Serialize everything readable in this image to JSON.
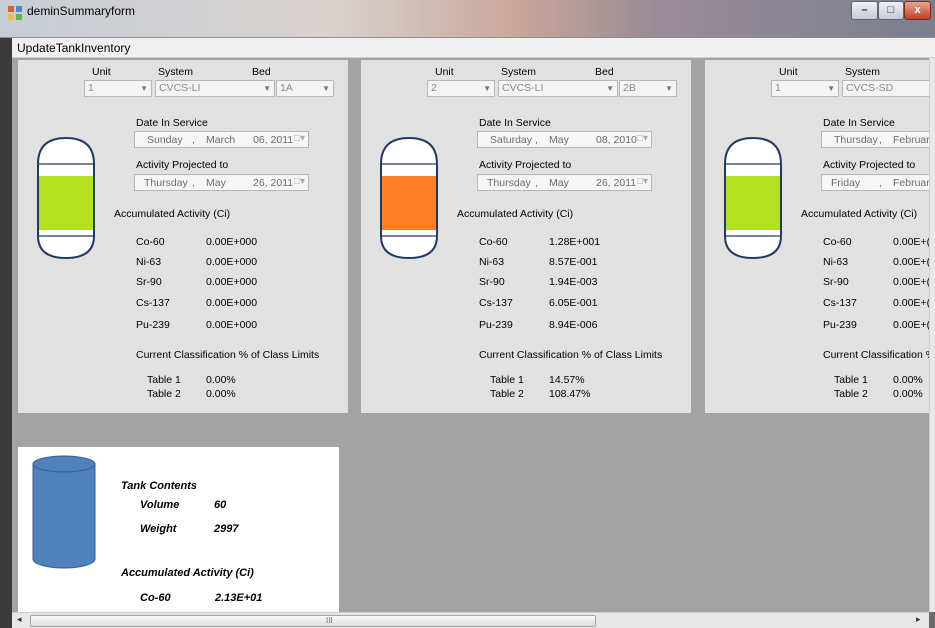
{
  "window": {
    "title": "deminSummaryform"
  },
  "menu": {
    "update_label": "UpdateTankInventory"
  },
  "caption": {
    "min": "–",
    "max": "□",
    "close": "x"
  },
  "panels": [
    {
      "headers": {
        "unit": "Unit",
        "system": "System",
        "bed": "Bed"
      },
      "unit": "1",
      "system": "CVCS-LI",
      "bed": "1A",
      "date_in_service_label": "Date In Service",
      "date_in_service": {
        "weekday": "Sunday",
        "comma1": ",",
        "month": "March",
        "day_year": "06, 2011"
      },
      "projected_label": "Activity Projected to",
      "projected": {
        "weekday": "Thursday",
        "comma1": ",",
        "month": "May",
        "day_year": "26, 2011"
      },
      "activity_label": "Accumulated Activity (Ci)",
      "nuclides": [
        {
          "name": "Co-60",
          "value": "0.00E+000"
        },
        {
          "name": "Ni-63",
          "value": "0.00E+000"
        },
        {
          "name": "Sr-90",
          "value": "0.00E+000"
        },
        {
          "name": "Cs-137",
          "value": "0.00E+000"
        },
        {
          "name": "Pu-239",
          "value": "0.00E+000"
        }
      ],
      "classification_label": "Current Classification % of Class Limits",
      "tables": [
        {
          "name": "Table 1",
          "value": "0.00%"
        },
        {
          "name": "Table 2",
          "value": "0.00%"
        }
      ],
      "tank_fill_color": "#b3e01f"
    },
    {
      "headers": {
        "unit": "Unit",
        "system": "System",
        "bed": "Bed"
      },
      "unit": "2",
      "system": "CVCS-LI",
      "bed": "2B",
      "date_in_service_label": "Date In Service",
      "date_in_service": {
        "weekday": "Saturday",
        "comma1": ",",
        "month": "May",
        "day_year": "08, 2010"
      },
      "projected_label": "Activity Projected to",
      "projected": {
        "weekday": "Thursday",
        "comma1": ",",
        "month": "May",
        "day_year": "26, 2011"
      },
      "activity_label": "Accumulated Activity (Ci)",
      "nuclides": [
        {
          "name": "Co-60",
          "value": "1.28E+001"
        },
        {
          "name": "Ni-63",
          "value": "8.57E-001"
        },
        {
          "name": "Sr-90",
          "value": "1.94E-003"
        },
        {
          "name": "Cs-137",
          "value": "6.05E-001"
        },
        {
          "name": "Pu-239",
          "value": "8.94E-006"
        }
      ],
      "classification_label": "Current Classification % of Class Limits",
      "tables": [
        {
          "name": "Table 1",
          "value": "14.57%"
        },
        {
          "name": "Table 2",
          "value": "108.47%"
        }
      ],
      "tank_fill_color": "#ff7f27"
    },
    {
      "headers": {
        "unit": "Unit",
        "system": "System",
        "bed": ""
      },
      "unit": "1",
      "system": "CVCS-SD",
      "bed": "",
      "date_in_service_label": "Date In Service",
      "date_in_service": {
        "weekday": "Thursday",
        "comma1": ",",
        "month": "February",
        "day_year": ""
      },
      "projected_label": "Activity Projected to",
      "projected": {
        "weekday": "Friday",
        "comma1": ",",
        "month": "February",
        "day_year": ""
      },
      "activity_label": "Accumulated Activity (Ci)",
      "nuclides": [
        {
          "name": "Co-60",
          "value": "0.00E+("
        },
        {
          "name": "Ni-63",
          "value": "0.00E+("
        },
        {
          "name": "Sr-90",
          "value": "0.00E+("
        },
        {
          "name": "Cs-137",
          "value": "0.00E+("
        },
        {
          "name": "Pu-239",
          "value": "0.00E+("
        }
      ],
      "classification_label": "Current Classification % o",
      "tables": [
        {
          "name": "Table 1",
          "value": "0.00%"
        },
        {
          "name": "Table 2",
          "value": "0.00%"
        }
      ],
      "tank_fill_color": "#b3e01f"
    }
  ],
  "summary": {
    "tank_contents_label": "Tank Contents",
    "volume_label": "Volume",
    "volume_value": "60",
    "weight_label": "Weight",
    "weight_value": "2997",
    "activity_label": "Accumulated Activity (Ci)",
    "co60_label": "Co-60",
    "co60_value": "2.13E+01",
    "tank_color": "#4f81bd"
  },
  "scroll": {
    "left_arrow": "◂",
    "right_arrow": "▸",
    "grip": "III"
  }
}
